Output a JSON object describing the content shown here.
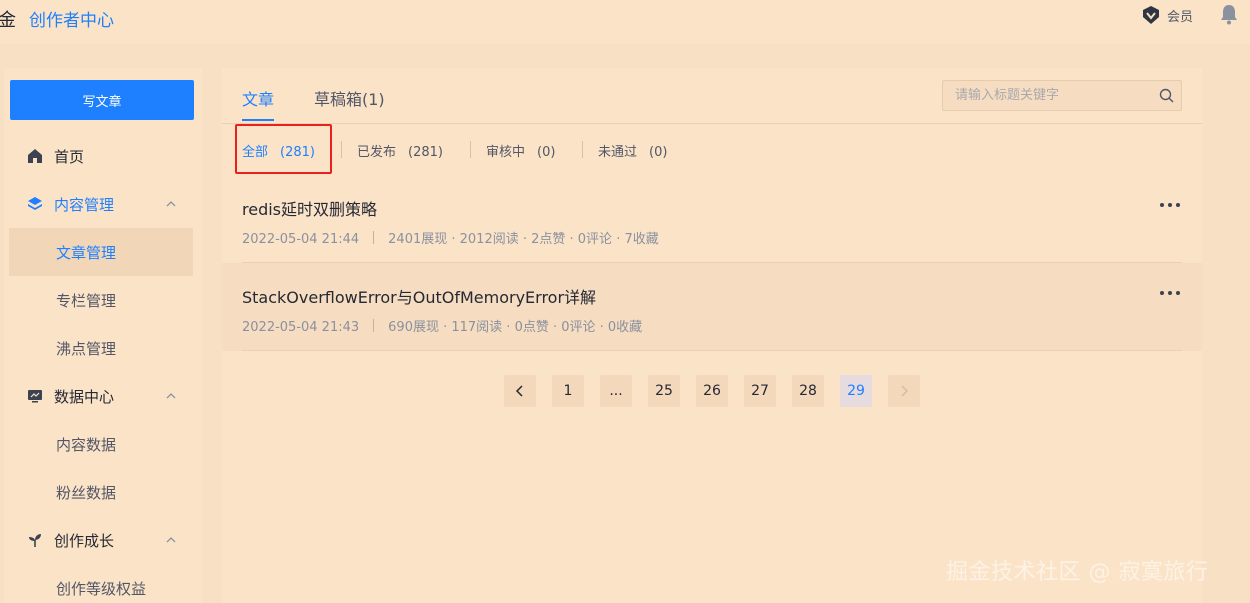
{
  "header": {
    "logo_glyph": "金",
    "brand_title": "创作者中心",
    "vip_label": "会员"
  },
  "sidebar": {
    "write_button": "写文章",
    "items": [
      {
        "label": "首页",
        "icon": "home-icon"
      },
      {
        "label": "内容管理",
        "icon": "layers-icon",
        "expanded": true
      },
      {
        "label": "文章管理",
        "sub": true,
        "active": true
      },
      {
        "label": "专栏管理",
        "sub": true
      },
      {
        "label": "沸点管理",
        "sub": true
      },
      {
        "label": "数据中心",
        "icon": "monitor-chart-icon",
        "expanded": true
      },
      {
        "label": "内容数据",
        "sub": true
      },
      {
        "label": "粉丝数据",
        "sub": true
      },
      {
        "label": "创作成长",
        "icon": "sprout-icon",
        "expanded": true
      },
      {
        "label": "创作等级权益",
        "sub": true
      }
    ]
  },
  "main": {
    "tabs": [
      {
        "label": "文章",
        "active": true
      },
      {
        "label": "草稿箱(1)",
        "active": false
      }
    ],
    "search": {
      "placeholder": "请输入标题关键字",
      "value": ""
    },
    "filters": [
      {
        "label": "全部",
        "count": "(281)",
        "active": true
      },
      {
        "label": "已发布",
        "count": "(281)"
      },
      {
        "label": "审核中",
        "count": "(0)"
      },
      {
        "label": "未通过",
        "count": "(0)"
      }
    ],
    "articles": [
      {
        "title": "redis延时双删策略",
        "date": "2022-05-04 21:44",
        "stats": "2401展现 · 2012阅读 · 2点赞 · 0评论 · 7收藏"
      },
      {
        "title": "StackOverflowError与OutOfMemoryError详解",
        "date": "2022-05-04 21:43",
        "stats": "690展现 · 117阅读 · 0点赞 · 0评论 · 0收藏"
      }
    ],
    "pagination": {
      "pages": [
        "1",
        "...",
        "25",
        "26",
        "27",
        "28",
        "29"
      ],
      "current": "29"
    }
  },
  "watermark": "掘金技术社区 @ 寂寞旅行",
  "colors": {
    "accent": "#1e80ff",
    "background": "#f8e0c4",
    "highlight": "#e8211f"
  }
}
